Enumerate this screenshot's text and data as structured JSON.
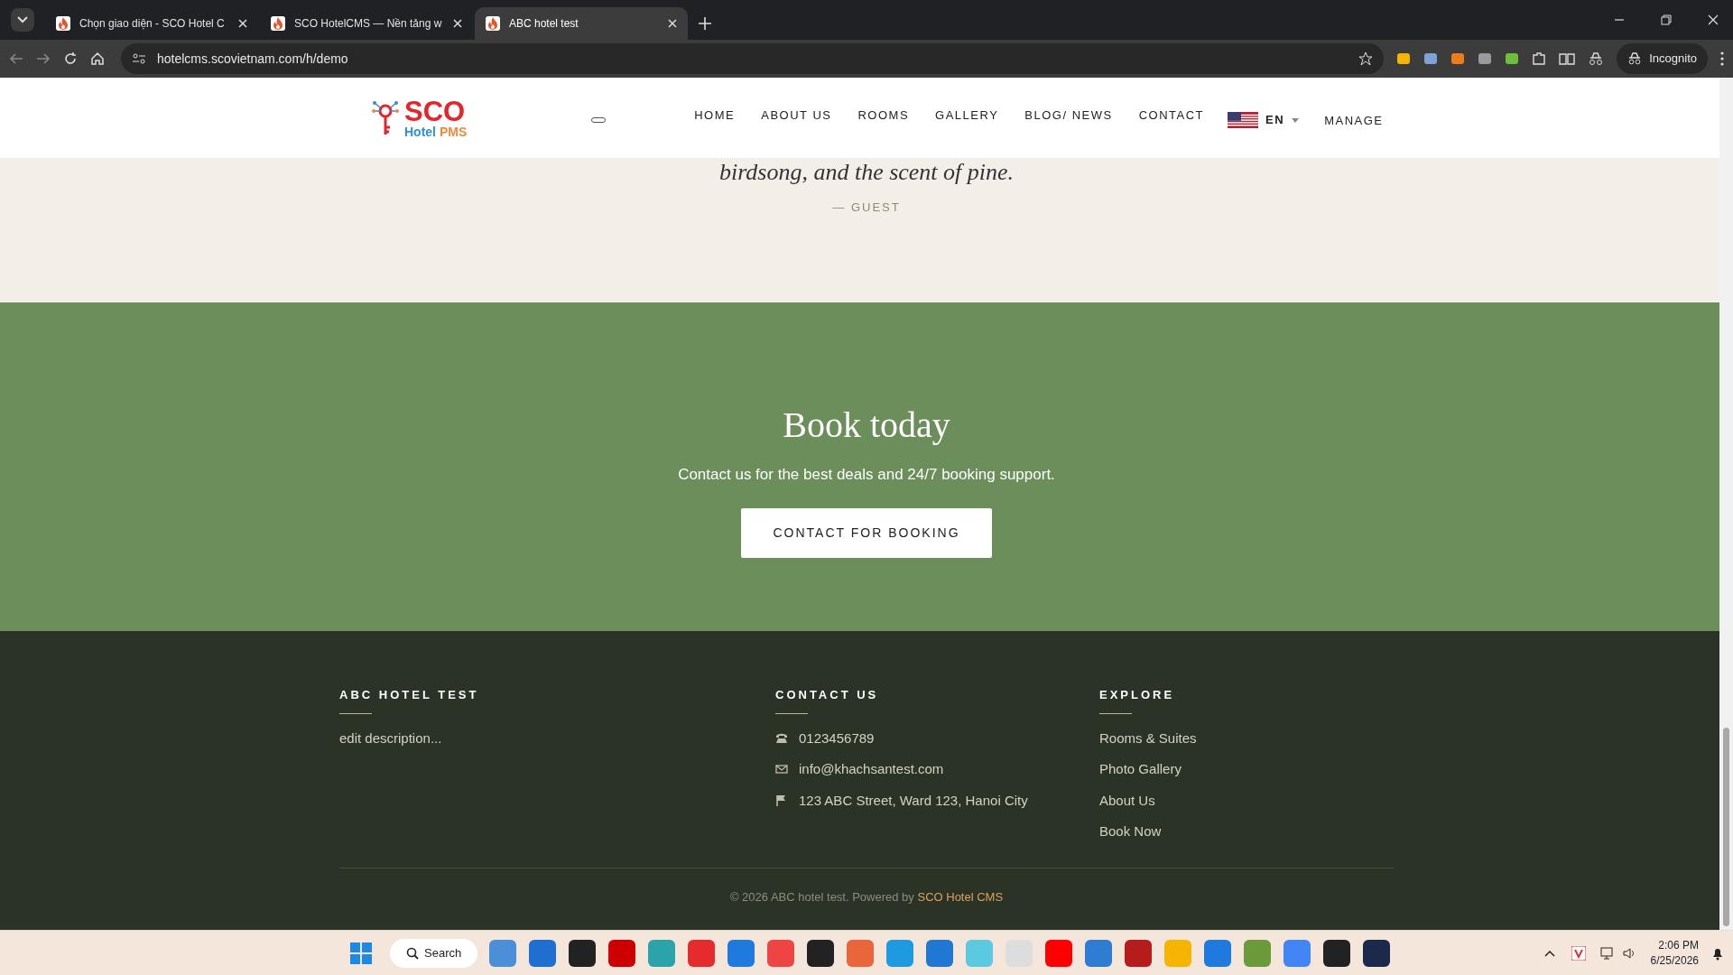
{
  "browser": {
    "tabs": [
      {
        "title": "Chọn giao diện - SCO Hotel C",
        "selected": false
      },
      {
        "title": "SCO HotelCMS — Nền tảng w",
        "selected": false
      },
      {
        "title": "ABC hotel test",
        "selected": true
      }
    ],
    "url": "hotelcms.scovietnam.com/h/demo",
    "profile": "Incognito"
  },
  "header": {
    "logo": {
      "title": "SCO",
      "subtitle_1": "Hotel",
      "subtitle_2": "PMS"
    },
    "nav": [
      {
        "label": "HOME"
      },
      {
        "label": "ABOUT US"
      },
      {
        "label": "ROOMS"
      },
      {
        "label": "GALLERY"
      },
      {
        "label": "BLOG/ NEWS"
      },
      {
        "label": "CONTACT"
      }
    ],
    "language": "EN",
    "manage": "MANAGE"
  },
  "testimonial": {
    "quote": "birdsong, and the scent of pine.",
    "author": "— GUEST"
  },
  "booking": {
    "title": "Book today",
    "text": "Contact us for the best deals and 24/7 booking support.",
    "button": "CONTACT FOR BOOKING"
  },
  "footer": {
    "about": {
      "heading": "ABC HOTEL TEST",
      "text": "edit description..."
    },
    "contact": {
      "heading": "CONTACT US",
      "items": [
        {
          "kind": "phone",
          "text": "0123456789"
        },
        {
          "kind": "email",
          "text": "info@khachsantest.com"
        },
        {
          "kind": "address",
          "text": "123 ABC Street, Ward 123, Hanoi City"
        }
      ]
    },
    "explore": {
      "heading": "EXPLORE",
      "links": [
        "Rooms & Suites",
        "Photo Gallery",
        "About Us",
        "Book Now"
      ]
    },
    "copyright": "© 2026 ABC hotel test. Powered by",
    "powered_link": "SCO Hotel CMS"
  },
  "taskbar": {
    "search": "Search",
    "time": "2:06 PM",
    "date": "6/25/2026"
  }
}
